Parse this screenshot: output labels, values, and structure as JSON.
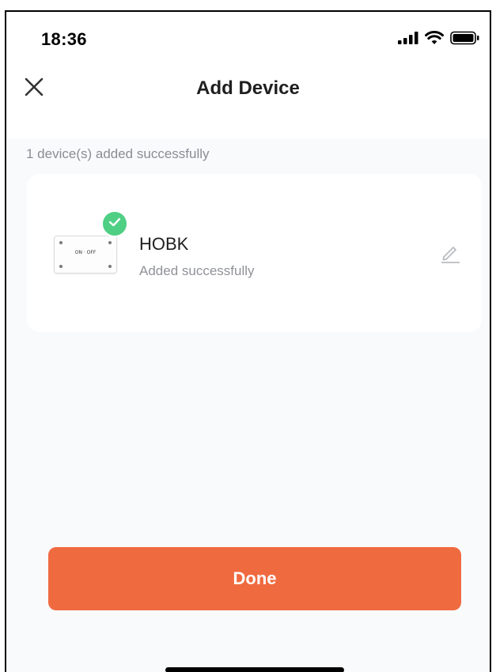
{
  "status_bar": {
    "time": "18:36",
    "icons": [
      "cellular-signal-icon",
      "wifi-icon",
      "battery-icon"
    ]
  },
  "nav": {
    "title": "Add Device",
    "close_icon": "close-icon"
  },
  "summary": "1 device(s) added successfully",
  "device": {
    "name": "HOBK",
    "status": "Added successfully",
    "thumbnail_label": "ON · OFF",
    "badge_icon": "check-icon",
    "edit_icon": "pencil-icon"
  },
  "done_button": {
    "label": "Done"
  },
  "colors": {
    "accent": "#f06a40",
    "success": "#4fcf84",
    "background": "#f9fafc"
  }
}
